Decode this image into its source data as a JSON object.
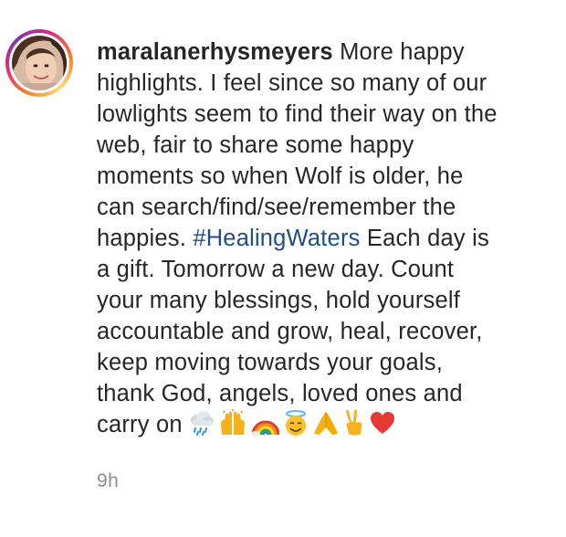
{
  "comment": {
    "username": "maralanerhysmeyers",
    "lines": {
      "l1": "More happy",
      "l2": "highlights. I feel since so many of our",
      "l3": "lowlights seem to find their way on the",
      "l4": "web, fair to share some happy",
      "l5": "moments so when Wolf is older, he",
      "l6": "can search/find/see/remember the",
      "l7_pre": "happies.",
      "hashtag": "#HealingWaters",
      "l7_post": "Each day is",
      "l8": "a gift. Tomorrow a new day. Count",
      "l9": "your many blessings, hold yourself",
      "l10": "accountable and grow, heal, recover,",
      "l11": "keep moving towards your goals,",
      "l12": "thank God, angels, loved ones and",
      "l13": "carry on"
    },
    "emojis": [
      "cloud-rain",
      "raising-hands",
      "rainbow",
      "smiling-face-with-halo",
      "folded-hands",
      "victory-hand",
      "red-heart"
    ],
    "timestamp": "9h"
  },
  "colors": {
    "text": "#262626",
    "hashtag": "#1f4d86",
    "timestamp": "#8e8e8e",
    "avatar_ring_start": "#f58529",
    "avatar_ring_end": "#dd2a7b"
  }
}
